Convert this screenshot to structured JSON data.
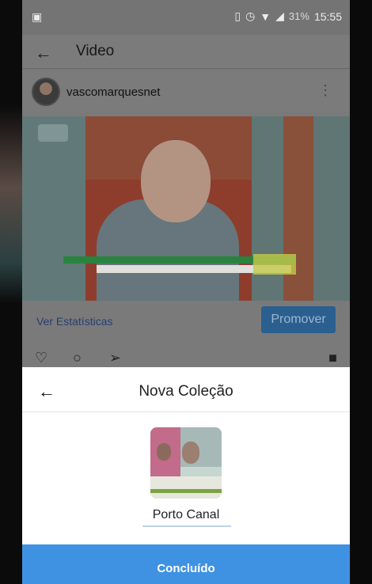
{
  "status_bar": {
    "battery": "31%",
    "time": "15:55",
    "icons": [
      "sim-icon",
      "alarm-icon",
      "wifi-icon",
      "signal-icon",
      "image-icon"
    ]
  },
  "header": {
    "title": "Video",
    "back_icon": "arrow-left-icon"
  },
  "post": {
    "username": "vascomarquesnet",
    "more_icon": "more-vertical-icon"
  },
  "actions": {
    "stats_link": "Ver Estatísticas",
    "promote_button": "Promover"
  },
  "sheet": {
    "title": "Nova Coleção",
    "collection_name": "Porto Canal",
    "done_button": "Concluído"
  }
}
